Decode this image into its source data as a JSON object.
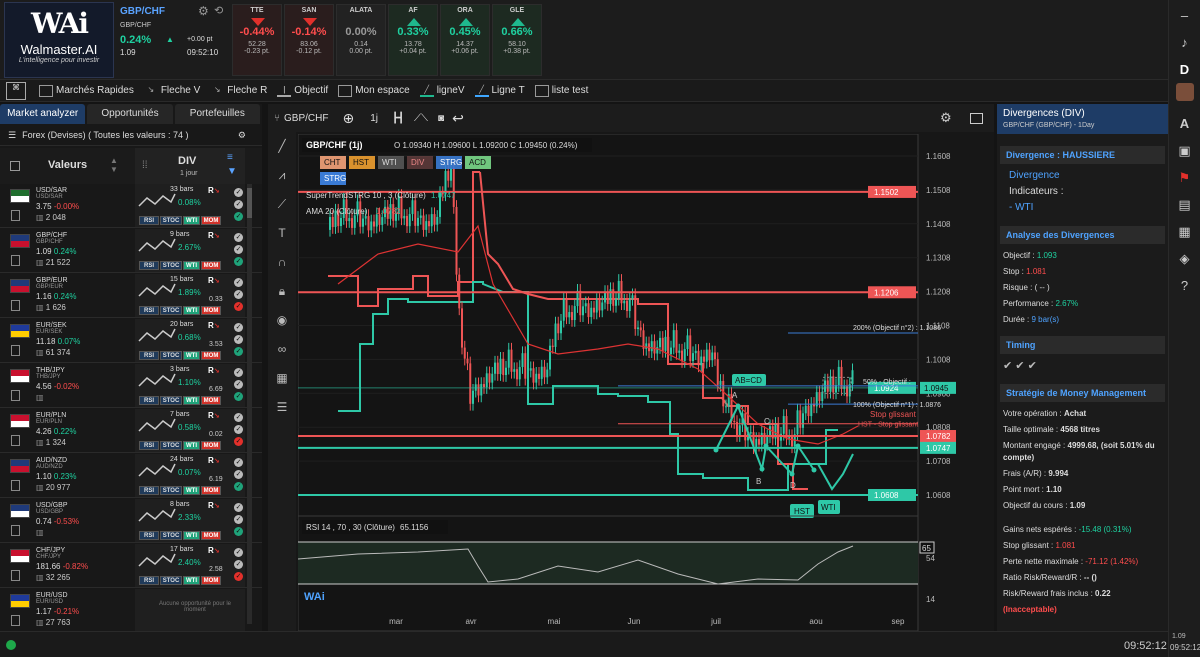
{
  "brand": {
    "logo_mark": "WAi",
    "name": "Walmaster.AI",
    "tagline": "L'intelligence pour investir"
  },
  "main_quote": {
    "symbol": "GBP/CHF",
    "sub": "GBP/CHF",
    "pct": "0.24%",
    "change": "+0.00 pt",
    "price": "1.09",
    "time": "09:52:10"
  },
  "tickers": [
    {
      "name": "TTE",
      "pct": "-0.44%",
      "price": "52.28",
      "delta": "-0.23 pt.",
      "dir": "dn"
    },
    {
      "name": "SAN",
      "pct": "-0.14%",
      "price": "83.06",
      "delta": "-0.12 pt.",
      "dir": "dn"
    },
    {
      "name": "ALATA",
      "pct": "0.00%",
      "price": "0.14",
      "delta": "0.00 pt.",
      "dir": "flat"
    },
    {
      "name": "AF",
      "pct": "0.33%",
      "price": "13.78",
      "delta": "+0.04 pt.",
      "dir": "up"
    },
    {
      "name": "ORA",
      "pct": "0.45%",
      "price": "14.37",
      "delta": "+0.06 pt.",
      "dir": "up"
    },
    {
      "name": "GLE",
      "pct": "0.66%",
      "price": "58.10",
      "delta": "+0.38 pt.",
      "dir": "up"
    }
  ],
  "toolbar": [
    "Marchés Rapides",
    "Fleche V",
    "Fleche R",
    "Objectif",
    "Mon espace",
    "ligneV",
    "Ligne T",
    "liste test"
  ],
  "tabs": [
    "Market analyzer",
    "Opportunités",
    "Portefeuilles"
  ],
  "market_label": "Forex (Devises) ( Toutes les valeurs : 74 )",
  "col_valeurs": "Valeurs",
  "col_div": "DIV",
  "col_div_sub": "1 jour",
  "rows": [
    {
      "sym": "USD/SAR",
      "sub": "USD/SAR",
      "price": "3.75",
      "chg": "-0.00%",
      "vol": "2 048",
      "bars": "33 bars",
      "bp": "0.08%",
      "r": "",
      "up": false,
      "flag": [
        "#1f6e2e",
        "#ffffff"
      ]
    },
    {
      "sym": "GBP/CHF",
      "sub": "GBP/CHF",
      "price": "1.09",
      "chg": "0.24%",
      "vol": "21 522",
      "bars": "9 bars",
      "bp": "2.67%",
      "r": "",
      "up": true,
      "flag": [
        "#1f3a7a",
        "#c8102e"
      ]
    },
    {
      "sym": "GBP/EUR",
      "sub": "GBP/EUR",
      "price": "1.16",
      "chg": "0.24%",
      "vol": "1 626",
      "bars": "15 bars",
      "bp": "1.89%",
      "r": "0.33",
      "up": true,
      "flag": [
        "#1f3a7a",
        "#c8102e"
      ]
    },
    {
      "sym": "EUR/SEK",
      "sub": "EUR/SEK",
      "price": "11.18",
      "chg": "0.07%",
      "vol": "61 374",
      "bars": "20 bars",
      "bp": "0.68%",
      "r": "3.53",
      "up": true,
      "flag": [
        "#1f3a9a",
        "#ffcc00"
      ]
    },
    {
      "sym": "THB/JPY",
      "sub": "THB/JPY",
      "price": "4.56",
      "chg": "-0.02%",
      "vol": "",
      "bars": "3 bars",
      "bp": "1.10%",
      "r": "6.69",
      "up": false,
      "flag": [
        "#c8102e",
        "#ffffff"
      ]
    },
    {
      "sym": "EUR/PLN",
      "sub": "EUR/PLN",
      "price": "4.26",
      "chg": "0.22%",
      "vol": "1 324",
      "bars": "7 bars",
      "bp": "0.58%",
      "r": "0.02",
      "up": true,
      "flag": [
        "#c8102e",
        "#ffffff"
      ]
    },
    {
      "sym": "AUD/NZD",
      "sub": "AUD/NZD",
      "price": "1.10",
      "chg": "0.23%",
      "vol": "20 977",
      "bars": "24 bars",
      "bp": "0.07%",
      "r": "6.19",
      "up": true,
      "flag": [
        "#1f3a7a",
        "#c8102e"
      ]
    },
    {
      "sym": "USD/GBP",
      "sub": "USD/GBP",
      "price": "0.74",
      "chg": "-0.53%",
      "vol": "",
      "bars": "8 bars",
      "bp": "2.33%",
      "r": "",
      "up": false,
      "flag": [
        "#1f3a7a",
        "#ffffff"
      ]
    },
    {
      "sym": "CHF/JPY",
      "sub": "CHF/JPY",
      "price": "181.66",
      "chg": "-0.82%",
      "vol": "32 265",
      "bars": "17 bars",
      "bp": "2.40%",
      "r": "2.58",
      "up": false,
      "flag": [
        "#c8102e",
        "#ffffff"
      ]
    },
    {
      "sym": "EUR/USD",
      "sub": "EUR/USD",
      "price": "1.17",
      "chg": "-0.21%",
      "vol": "27 763",
      "bars": "",
      "bp": "",
      "r": "",
      "up": false,
      "flag": [
        "#1f3a9a",
        "#ffcc00"
      ]
    }
  ],
  "no_opportunity": "Aucune opportunité pour le moment",
  "tag_labels": [
    "RSI",
    "STOC",
    "WTI",
    "MOM"
  ],
  "chart": {
    "pair": "GBP/CHF",
    "interval": "1j",
    "title": "GBP/CHF (1j)",
    "ohlc": "O 1.09340 H 1.09600 L 1.09200 C 1.09450 (0.24%)",
    "indicators": [
      "CHT",
      "HST",
      "WTI",
      "DIV",
      "STRG",
      "ACD"
    ],
    "strg": "STRG",
    "supertrend": "SuperTrendSTRG 10 , 3 (Clôture)",
    "supertrend_val": "1.0747",
    "ama": "AMA 20 (Clôture)",
    "ama_val": "1.0782",
    "rsi": "RSI 14 , 70 , 30 (Clôture)",
    "rsi_val": "65.1156",
    "levels": [
      "1.1502",
      "1.1206",
      "1.0924",
      "1.0782",
      "1.0747",
      "1.0608"
    ],
    "yticks": [
      "1.1608",
      "1.1508",
      "1.1408",
      "1.1308",
      "1.1208",
      "1.1108",
      "1.1008",
      "1.0908",
      "1.0808",
      "1.0708",
      "1.0608"
    ],
    "xticks": [
      "mar",
      "avr",
      "mai",
      "Jun",
      "juil",
      "aou",
      "sep"
    ],
    "current": "1.0945",
    "obj2": "200% (Objectif n°2) : 1.1086",
    "obj1": "100% (Objectif n°1) : 1.0876",
    "obj50": "50% - Objectif :",
    "stop1": "Stop glissant",
    "stop2": "HST - Stop glissant",
    "abcd": "AB=CD",
    "pts": [
      "A",
      "B",
      "C",
      "D"
    ],
    "hst": "HST",
    "wti": "WTI",
    "rsi_ticks": [
      "65",
      "54",
      "14"
    ]
  },
  "right": {
    "title": "Divergences (DIV)",
    "sub": "GBP/CHF (GBP/CHF) - 1Day",
    "div_head": "Divergence : HAUSSIERE",
    "div_l1": "Divergence",
    "div_l2": "Indicateurs :",
    "div_l3": "- WTI",
    "analyse": "Analyse des Divergences",
    "objectif_l": "Objectif :",
    "objectif_v": "1.093",
    "stop_l": "Stop :",
    "stop_v": "1.081",
    "risque_l": "Risque :",
    "risque_v": "( -- )",
    "perf_l": "Performance :",
    "perf_v": "2.67%",
    "duree_l": "Durée :",
    "duree_v": "9 bar(s)",
    "timing": "Timing",
    "money": "Stratégie de Money Management",
    "m1_l": "Votre opération :",
    "m1_v": "Achat",
    "m2_l": "Taille optimale :",
    "m2_v": "4568 titres",
    "m3_l": "Montant engagé :",
    "m3_v": "4999.68,",
    "m3_x": "(soit 5.01% du compte)",
    "m4_l": "Frais (A/R) :",
    "m4_v": "9.994",
    "m5_l": "Point mort :",
    "m5_v": "1.10",
    "m6_l": "Objectif du cours :",
    "m6_v": "1.09",
    "g1_l": "Gains nets espérés :",
    "g1_v": "-15.48 (0.31%)",
    "g2_l": "Stop glissant :",
    "g2_v": "1.081",
    "g3_l": "Perte nette maximale :",
    "g3_v": "-71.12 (1.42%)",
    "g4_l": "Ratio Risk/Reward/R :",
    "g4_v": "-- ()",
    "g5_l": "Risk/Reward frais inclus :",
    "g5_v": "0.22",
    "g6_v": "(Inacceptable)"
  },
  "clock": "09:52:12",
  "status_time": "09:52:12",
  "status_date": "1.09"
}
